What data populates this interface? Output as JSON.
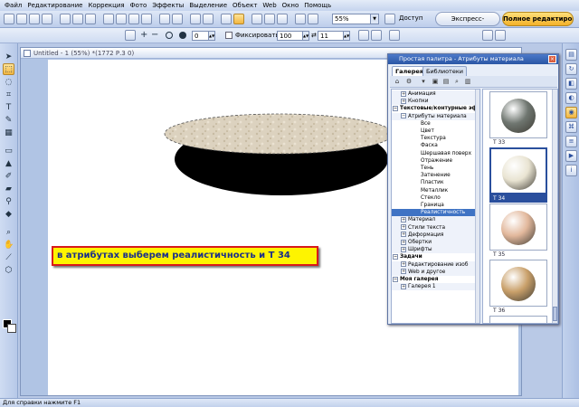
{
  "menu": [
    "Файл",
    "Редактирование",
    "Коррекция",
    "Фото",
    "Эффекты",
    "Выделение",
    "Объект",
    "Web",
    "Окно",
    "Помощь"
  ],
  "toolbar": {
    "zoom": "55%",
    "access_label": "Доступ",
    "express_label": "Экспресс-коррекция",
    "full_label": "Полное редактиров..."
  },
  "toolbar2": {
    "field1": "0",
    "fix_label": "Фиксировать",
    "field2": "100",
    "field3": "11"
  },
  "document": {
    "title": "Untitled - 1 (55%) *(1772 Р.3 0)",
    "annotation": "в атрибутах выберем реалистичность и Т 34"
  },
  "palette": {
    "title": "Простая палитра - Атрибуты материала",
    "tabs": [
      "Галерея",
      "Библиотеки"
    ],
    "tree": [
      {
        "label": "Анимация",
        "kind": "sub",
        "exp": "+"
      },
      {
        "label": "Кнопки",
        "kind": "sub",
        "exp": "+"
      },
      {
        "label": "Текстовые/контурные эф",
        "kind": "cat",
        "exp": "−"
      },
      {
        "label": "Атрибуты материала",
        "kind": "sub",
        "exp": "−"
      },
      {
        "label": "Все",
        "kind": "leaf"
      },
      {
        "label": "Цвет",
        "kind": "leaf"
      },
      {
        "label": "Текстура",
        "kind": "leaf"
      },
      {
        "label": "Фаска",
        "kind": "leaf"
      },
      {
        "label": "Шершавая поверх",
        "kind": "leaf"
      },
      {
        "label": "Отражение",
        "kind": "leaf"
      },
      {
        "label": "Тень",
        "kind": "leaf"
      },
      {
        "label": "Затенение",
        "kind": "leaf"
      },
      {
        "label": "Пластик",
        "kind": "leaf"
      },
      {
        "label": "Металлик",
        "kind": "leaf"
      },
      {
        "label": "Стекло",
        "kind": "leaf"
      },
      {
        "label": "Граница",
        "kind": "leaf"
      },
      {
        "label": "Реалистичность",
        "kind": "leaf",
        "selected": true
      },
      {
        "label": "Материал",
        "kind": "sub",
        "exp": "+"
      },
      {
        "label": "Стили текста",
        "kind": "sub",
        "exp": "+"
      },
      {
        "label": "Деформация",
        "kind": "sub",
        "exp": "+"
      },
      {
        "label": "Обертки",
        "kind": "sub",
        "exp": "+"
      },
      {
        "label": "Шрифты",
        "kind": "sub",
        "exp": "+"
      },
      {
        "label": "Задачи",
        "kind": "cat",
        "exp": "−"
      },
      {
        "label": "Редактирование изоб",
        "kind": "sub",
        "exp": "+"
      },
      {
        "label": "Web и другое",
        "kind": "sub",
        "exp": "+"
      },
      {
        "label": "Моя галерея",
        "kind": "cat",
        "exp": "−"
      },
      {
        "label": "Галерея 1",
        "kind": "sub",
        "exp": "+"
      }
    ],
    "thumbs": [
      {
        "label": "T 33",
        "color": "#6f7670",
        "selected": false
      },
      {
        "label": "T 34",
        "color": "#e9e4d2",
        "selected": true
      },
      {
        "label": "T 35",
        "color": "#e2b89c",
        "selected": false
      },
      {
        "label": "T 36",
        "color": "#c9a06a",
        "selected": false
      },
      {
        "label": "",
        "color": "#e6c9a8",
        "selected": false
      }
    ]
  },
  "status": "Для справки нажмите F1",
  "colors": {
    "foreground": "#000000",
    "background": "#ffffff",
    "annotation_bg": "#fef400",
    "annotation_border": "#d81a1a",
    "selection": "#3f73c4"
  }
}
